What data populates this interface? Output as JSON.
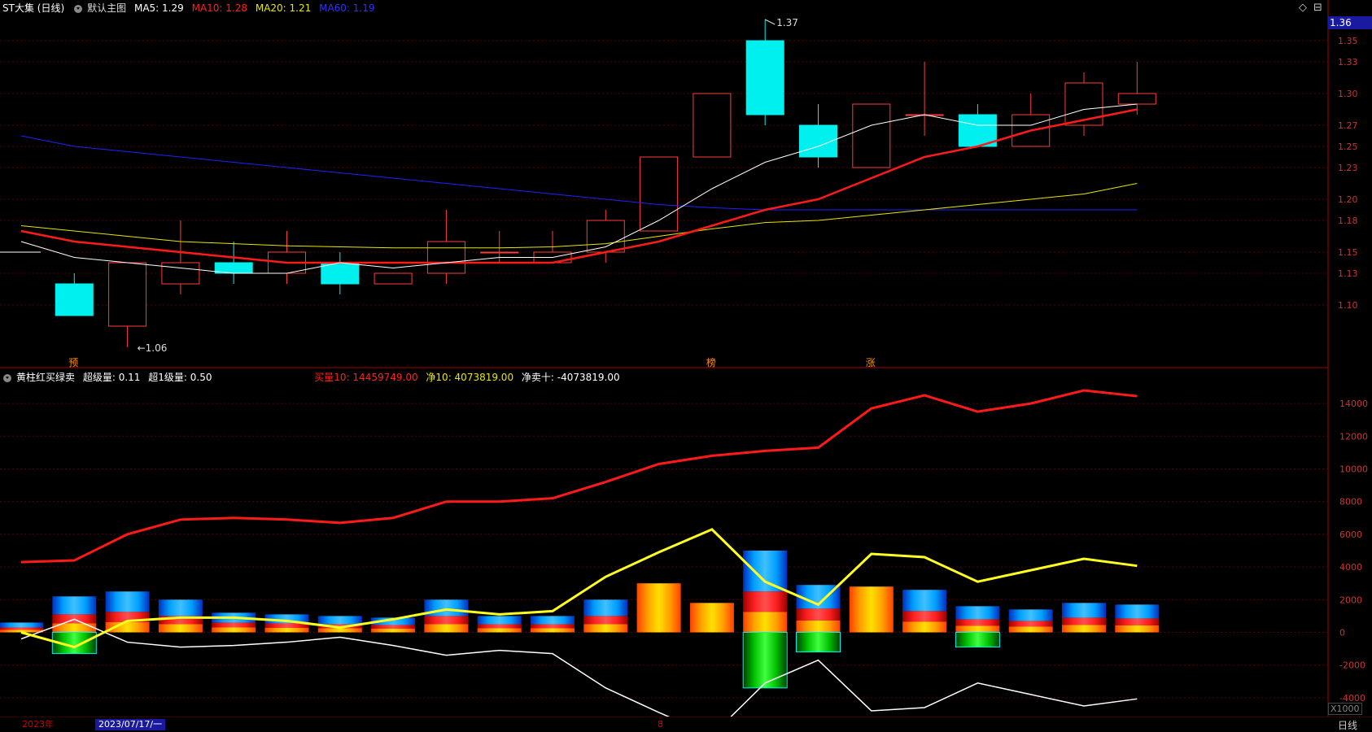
{
  "header_main": {
    "stock": "ST大集 (日线)",
    "template": "默认主图",
    "ma5": "MA5: 1.29",
    "ma10": "MA10: 1.28",
    "ma20": "MA20: 1.21",
    "ma60": "MA60: 1.19"
  },
  "header_sub": {
    "indicator": "黄柱红买绿卖",
    "super": "超级量: 0.11",
    "super1": "超1级量: 0.50",
    "buy10": "买量10: 14459749.00",
    "net10": "净10: 4073819.00",
    "netsell": "净卖十: -4073819.00"
  },
  "price_tag": "1.36",
  "corner_icons": [
    "◇",
    "⊟"
  ],
  "marks": {
    "high_label": "1.37",
    "low_label": "1.06",
    "ticks_price": [
      "1.35",
      "1.33",
      "1.30",
      "1.27",
      "1.25",
      "1.23",
      "1.20",
      "1.18",
      "1.15",
      "1.13",
      "1.10"
    ],
    "ticks_vol": [
      "14000",
      "12000",
      "10000",
      "8000",
      "6000",
      "4000",
      "2000",
      "0",
      "-2000",
      "-4000"
    ]
  },
  "candle_markers": [
    "预",
    "榜",
    "涨"
  ],
  "bottom": {
    "year": "2023年",
    "date": "2023/07/17/一",
    "month": "8",
    "period": "日线",
    "scale": "X1000"
  },
  "colors": {
    "up": "#ff3b3b",
    "down": "#00f0f0",
    "ma5": "#ffffff",
    "ma10": "#ff1a1a",
    "ma20": "#e6e600",
    "ma60": "#2020ff",
    "grid": "#5a0000"
  },
  "chart_data": [
    {
      "type": "candlestick",
      "price_range": [
        1.05,
        1.37
      ],
      "candles": [
        {
          "o": 1.15,
          "h": 1.15,
          "l": 1.15,
          "c": 1.15
        },
        {
          "o": 1.12,
          "h": 1.13,
          "l": 1.09,
          "c": 1.09
        },
        {
          "o": 1.08,
          "h": 1.14,
          "l": 1.06,
          "c": 1.14
        },
        {
          "o": 1.12,
          "h": 1.18,
          "l": 1.11,
          "c": 1.14
        },
        {
          "o": 1.14,
          "h": 1.16,
          "l": 1.12,
          "c": 1.13
        },
        {
          "o": 1.13,
          "h": 1.17,
          "l": 1.12,
          "c": 1.15
        },
        {
          "o": 1.14,
          "h": 1.15,
          "l": 1.11,
          "c": 1.12
        },
        {
          "o": 1.12,
          "h": 1.13,
          "l": 1.12,
          "c": 1.13
        },
        {
          "o": 1.13,
          "h": 1.19,
          "l": 1.12,
          "c": 1.16
        },
        {
          "o": 1.15,
          "h": 1.17,
          "l": 1.14,
          "c": 1.15
        },
        {
          "o": 1.14,
          "h": 1.17,
          "l": 1.14,
          "c": 1.15
        },
        {
          "o": 1.15,
          "h": 1.19,
          "l": 1.14,
          "c": 1.18
        },
        {
          "o": 1.17,
          "h": 1.23,
          "l": 1.17,
          "c": 1.24
        },
        {
          "o": 1.24,
          "h": 1.3,
          "l": 1.24,
          "c": 1.3
        },
        {
          "o": 1.35,
          "h": 1.37,
          "l": 1.27,
          "c": 1.28
        },
        {
          "o": 1.27,
          "h": 1.29,
          "l": 1.23,
          "c": 1.24
        },
        {
          "o": 1.23,
          "h": 1.29,
          "l": 1.23,
          "c": 1.29
        },
        {
          "o": 1.28,
          "h": 1.33,
          "l": 1.26,
          "c": 1.28
        },
        {
          "o": 1.28,
          "h": 1.29,
          "l": 1.25,
          "c": 1.25
        },
        {
          "o": 1.25,
          "h": 1.3,
          "l": 1.25,
          "c": 1.28
        },
        {
          "o": 1.27,
          "h": 1.32,
          "l": 1.26,
          "c": 1.31
        },
        {
          "o": 1.29,
          "h": 1.33,
          "l": 1.28,
          "c": 1.3
        }
      ],
      "ma5": [
        1.16,
        1.145,
        1.14,
        1.135,
        1.13,
        1.13,
        1.14,
        1.135,
        1.14,
        1.145,
        1.145,
        1.155,
        1.18,
        1.21,
        1.235,
        1.25,
        1.27,
        1.28,
        1.27,
        1.27,
        1.285,
        1.29
      ],
      "ma10": [
        1.17,
        1.16,
        1.155,
        1.15,
        1.145,
        1.14,
        1.14,
        1.14,
        1.14,
        1.14,
        1.14,
        1.15,
        1.16,
        1.175,
        1.19,
        1.2,
        1.22,
        1.24,
        1.25,
        1.265,
        1.275,
        1.285
      ],
      "ma20": [
        1.175,
        1.17,
        1.165,
        1.16,
        1.158,
        1.156,
        1.155,
        1.154,
        1.154,
        1.154,
        1.155,
        1.158,
        1.165,
        1.172,
        1.178,
        1.18,
        1.185,
        1.19,
        1.195,
        1.2,
        1.205,
        1.215
      ],
      "ma60": [
        1.26,
        1.25,
        1.245,
        1.24,
        1.235,
        1.23,
        1.225,
        1.22,
        1.215,
        1.21,
        1.205,
        1.2,
        1.195,
        1.192,
        1.19,
        1.19,
        1.19,
        1.19,
        1.19,
        1.19,
        1.19,
        1.19
      ]
    },
    {
      "type": "bar",
      "range": [
        -5000,
        15000
      ],
      "buy_line": [
        4300,
        4400,
        6000,
        6900,
        7000,
        6900,
        6700,
        7000,
        8000,
        8000,
        8200,
        9200,
        10300,
        10800,
        11100,
        11300,
        13700,
        14500,
        13500,
        14000,
        14800,
        14450
      ],
      "net_line": [
        0,
        -900,
        700,
        900,
        900,
        700,
        300,
        800,
        1400,
        1100,
        1300,
        3400,
        4900,
        6300,
        3100,
        1700,
        4800,
        4600,
        3100,
        3800,
        4500,
        4070
      ],
      "sell_line": [
        -400,
        800,
        -600,
        -900,
        -800,
        -600,
        -300,
        -800,
        -1400,
        -1100,
        -1300,
        -3400,
        -4900,
        -6300,
        -3100,
        -1700,
        -4800,
        -4600,
        -3100,
        -3800,
        -4500,
        -4070
      ],
      "bars_pos": [
        600,
        2200,
        2500,
        2000,
        1200,
        1100,
        1000,
        900,
        2000,
        1000,
        1000,
        2000,
        3000,
        1800,
        5000,
        2900,
        2800,
        2600,
        1600,
        1400,
        1800,
        1700
      ],
      "bars_neg": [
        0,
        -1300,
        0,
        0,
        0,
        0,
        0,
        0,
        0,
        0,
        0,
        0,
        0,
        0,
        -3400,
        -1200,
        0,
        0,
        -900,
        0,
        0,
        0
      ]
    }
  ]
}
